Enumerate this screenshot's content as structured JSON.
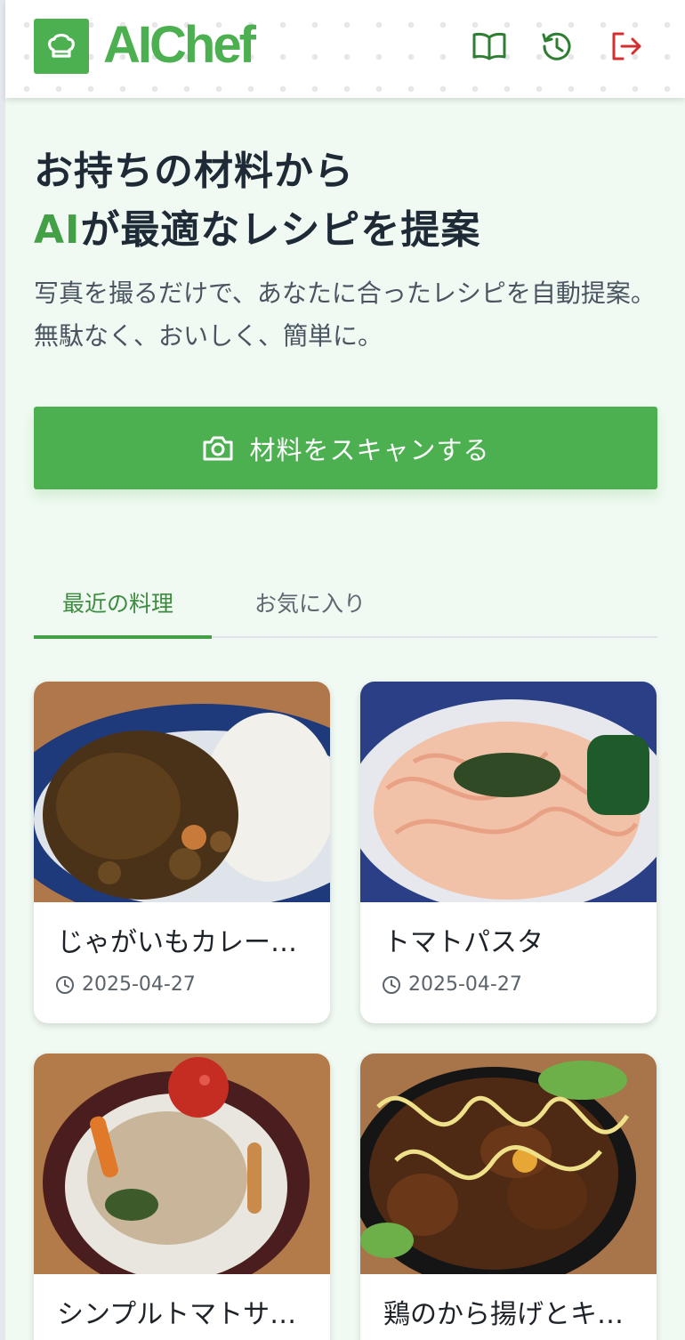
{
  "app": {
    "brand": "AIChef",
    "brand_color": "#4caf50"
  },
  "header": {
    "icons": [
      "recipe-book-icon",
      "history-icon",
      "logout-icon"
    ]
  },
  "hero": {
    "title_line1": "お持ちの材料から",
    "title_accent": "AI",
    "title_line2_rest": "が最適なレシピを提案",
    "description": "写真を撮るだけで、あなたに合ったレシピを自動提案。 無駄なく、おいしく、簡単に。"
  },
  "scan_button": {
    "label": "材料をスキャンする",
    "icon": "camera-icon"
  },
  "tabs": [
    {
      "label": "最近の料理",
      "active": true
    },
    {
      "label": "お気に入り",
      "active": false
    }
  ],
  "recipes": [
    {
      "name": "じゃがいもカレー…",
      "date": "2025-04-27"
    },
    {
      "name": "トマトパスタ",
      "date": "2025-04-27"
    },
    {
      "name": "シンプルトマトサ…",
      "date": ""
    },
    {
      "name": "鶏のから揚げとキ…",
      "date": ""
    }
  ]
}
